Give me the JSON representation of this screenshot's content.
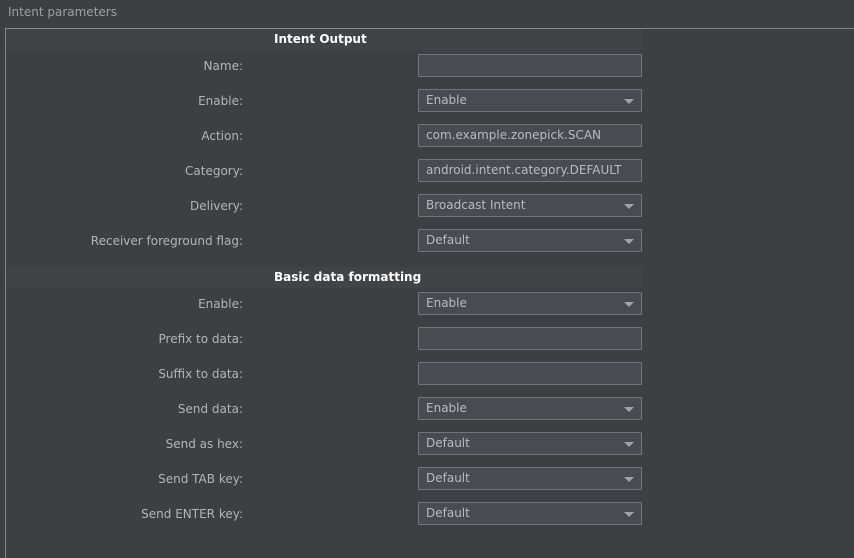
{
  "page": {
    "title": "Intent parameters"
  },
  "sections": [
    {
      "title": "Intent Output",
      "rows": [
        {
          "label": "Name:",
          "type": "text",
          "value": ""
        },
        {
          "label": "Enable:",
          "type": "dropdown",
          "value": "Enable"
        },
        {
          "label": "Action:",
          "type": "text",
          "value": "com.example.zonepick.SCAN"
        },
        {
          "label": "Category:",
          "type": "text",
          "value": "android.intent.category.DEFAULT"
        },
        {
          "label": "Delivery:",
          "type": "dropdown",
          "value": "Broadcast Intent"
        },
        {
          "label": "Receiver foreground flag:",
          "type": "dropdown",
          "value": "Default"
        }
      ]
    },
    {
      "title": "Basic data formatting",
      "rows": [
        {
          "label": "Enable:",
          "type": "dropdown",
          "value": "Enable"
        },
        {
          "label": "Prefix to data:",
          "type": "text",
          "value": ""
        },
        {
          "label": "Suffix to data:",
          "type": "text",
          "value": ""
        },
        {
          "label": "Send data:",
          "type": "dropdown",
          "value": "Enable"
        },
        {
          "label": "Send as hex:",
          "type": "dropdown",
          "value": "Default"
        },
        {
          "label": "Send TAB key:",
          "type": "dropdown",
          "value": "Default"
        },
        {
          "label": "Send ENTER key:",
          "type": "dropdown",
          "value": "Default"
        }
      ]
    }
  ],
  "icons": {
    "dropdown_arrow": "chevron-down-icon"
  },
  "colors": {
    "background": "#3c4043",
    "panel_border": "#80878d",
    "section_band": "#414447",
    "field_background": "#484c50",
    "field_border": "#6f767c",
    "label_text": "#b0b5ba",
    "value_text": "#b7bcc1",
    "section_title_text": "#ffffff",
    "page_title_text": "#9ba0a5"
  }
}
